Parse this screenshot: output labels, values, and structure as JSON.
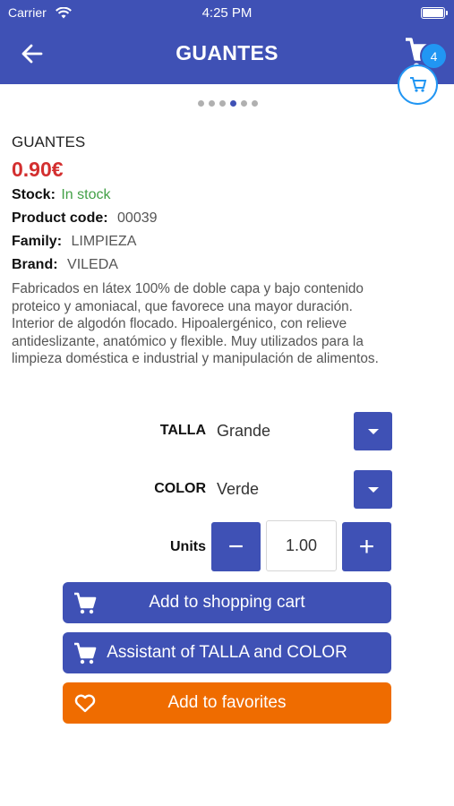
{
  "status_bar": {
    "carrier": "Carrier",
    "time": "4:25 PM"
  },
  "header": {
    "title": "GUANTES",
    "cart_count": "4"
  },
  "carousel": {
    "dots": 6,
    "active_index": 3
  },
  "product": {
    "name": "GUANTES",
    "price": "0.90€",
    "stock_label": "Stock:",
    "stock_value": "In stock",
    "code_label": "Product code:",
    "code_value": "00039",
    "family_label": "Family:",
    "family_value": "LIMPIEZA",
    "brand_label": "Brand:",
    "brand_value": "VILEDA",
    "description_lines": [
      "Fabricados en látex 100% de doble capa y bajo contenido",
      "proteico y amoniacal, que favorece una mayor duración.",
      "Interior de algodón flocado. Hipoalergénico, con relieve",
      "antideslizante, anatómico y flexible. Muy utilizados para la",
      "limpieza doméstica e industrial y manipulación de alimentos."
    ]
  },
  "options": {
    "talla_label": "TALLA",
    "talla_value": "Grande",
    "color_label": "COLOR",
    "color_value": "Verde",
    "units_label": "Units",
    "units_value": "1.00",
    "minus": "−",
    "plus": "+"
  },
  "actions": {
    "add_to_cart": "Add to shopping cart",
    "assistant": "Assistant of TALLA and COLOR",
    "favorites": "Add to favorites"
  },
  "colors": {
    "primary": "#3f51b5",
    "accent": "#2196f3",
    "price": "#d32f2f",
    "in_stock": "#43a047",
    "favorite": "#ef6c00"
  }
}
